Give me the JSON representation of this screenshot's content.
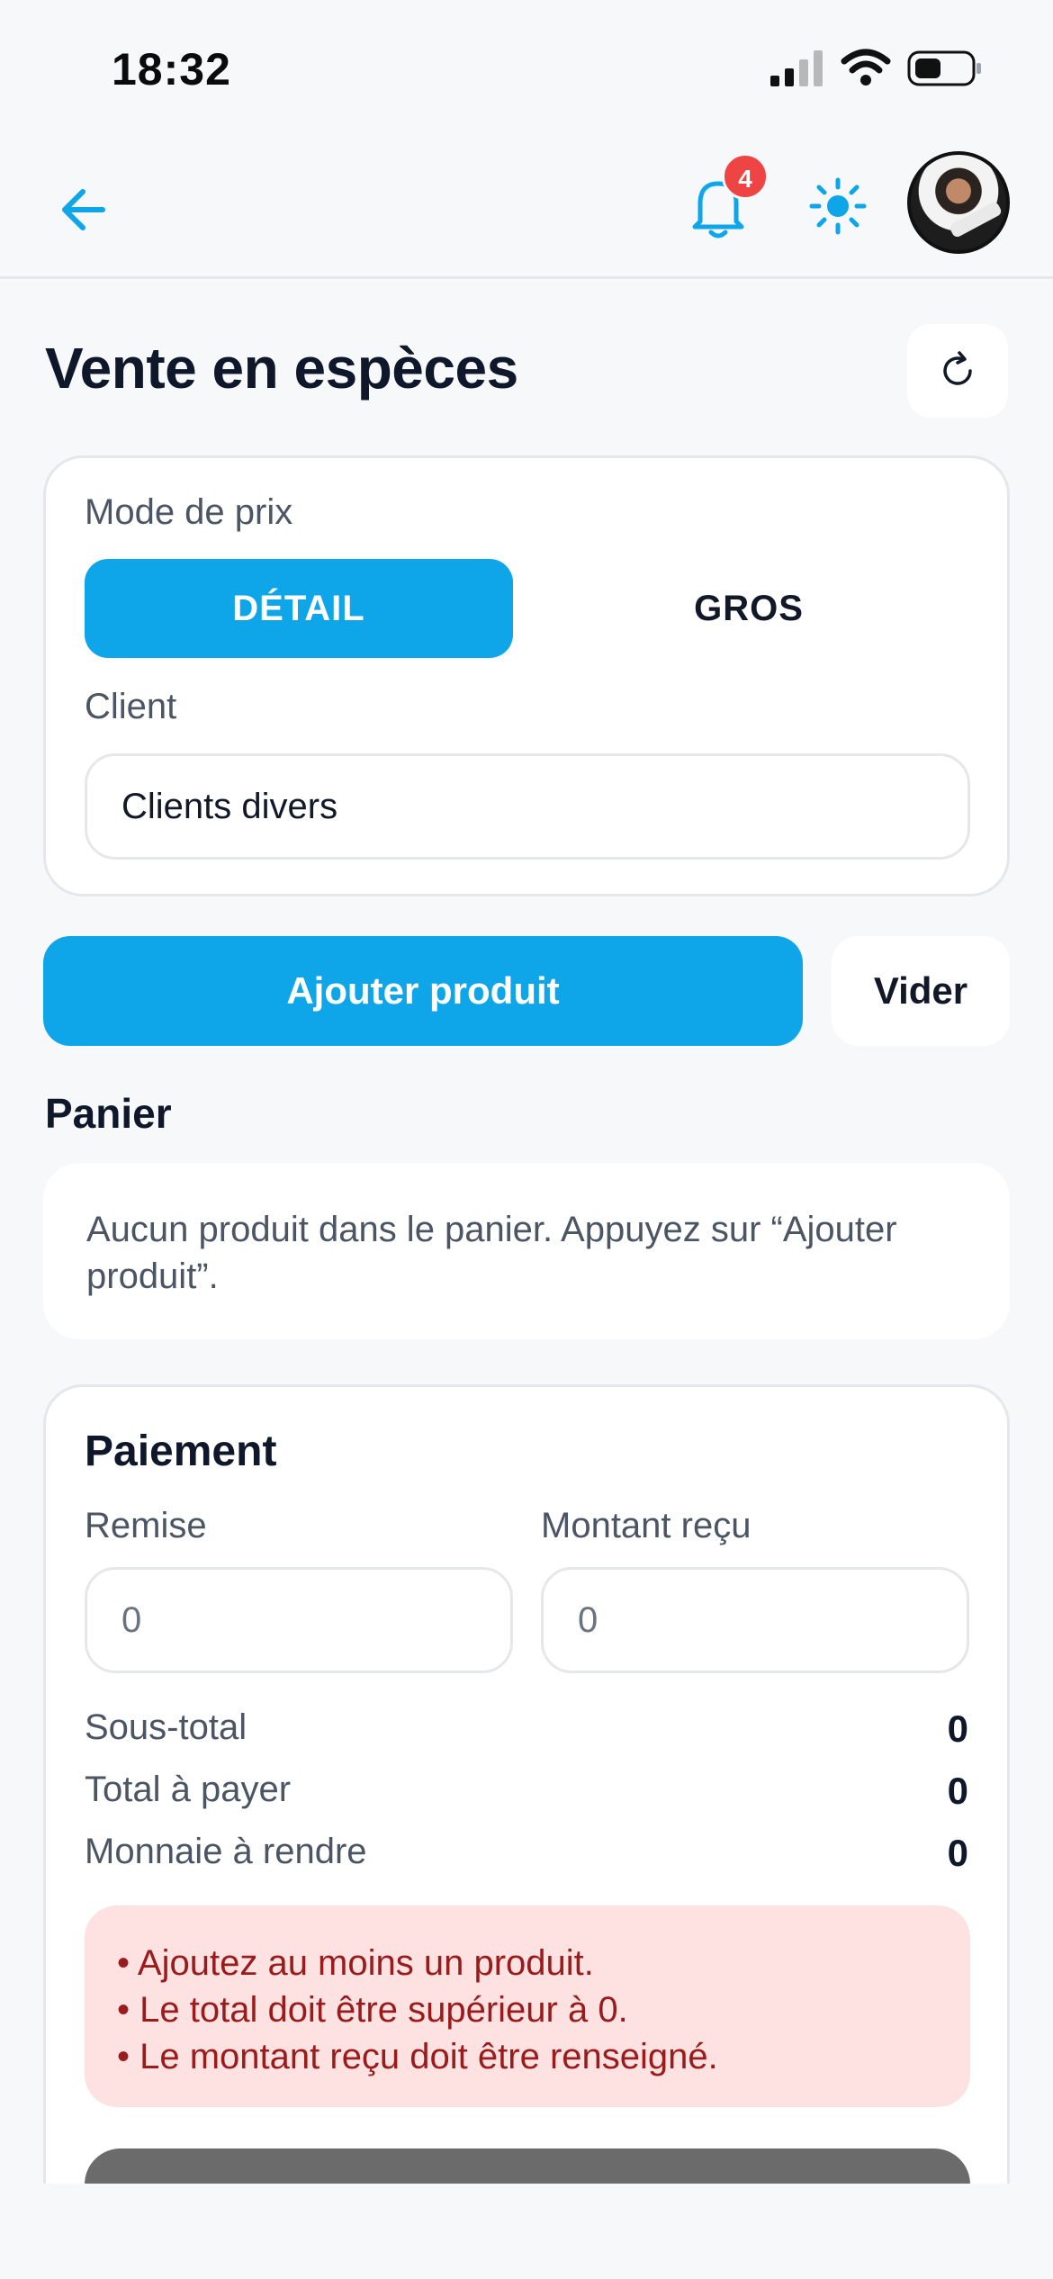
{
  "status_bar": {
    "time": "18:32"
  },
  "header": {
    "notification_count": "4"
  },
  "page": {
    "title": "Vente en espèces"
  },
  "pricing": {
    "label": "Mode de prix",
    "options": [
      "DÉTAIL",
      "GROS"
    ],
    "selected": "DÉTAIL"
  },
  "client": {
    "label": "Client",
    "value": "Clients divers"
  },
  "actions": {
    "add_label": "Ajouter produit",
    "clear_label": "Vider"
  },
  "cart": {
    "title": "Panier",
    "empty_message": "Aucun produit dans le panier. Appuyez sur “Ajouter produit”."
  },
  "payment": {
    "title": "Paiement",
    "discount_label": "Remise",
    "discount_placeholder": "0",
    "received_label": "Montant reçu",
    "received_placeholder": "0",
    "rows": [
      {
        "label": "Sous-total",
        "value": "0"
      },
      {
        "label": "Total à payer",
        "value": "0"
      },
      {
        "label": "Monnaie à rendre",
        "value": "0"
      }
    ],
    "errors": [
      "• Ajoutez au moins un produit.",
      "• Le total doit être supérieur à 0.",
      "• Le montant reçu doit être renseigné."
    ]
  },
  "colors": {
    "accent": "#0ea5e9",
    "badge": "#ef4444",
    "error_bg": "#fee2e2",
    "error_text": "#991b1b"
  }
}
